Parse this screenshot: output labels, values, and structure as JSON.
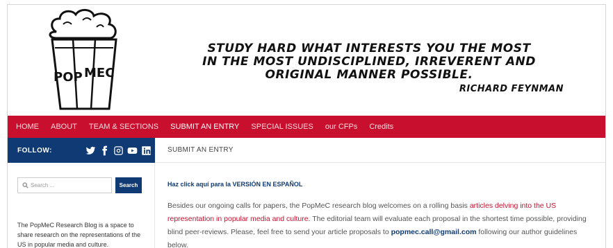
{
  "header": {
    "logo_text_1": "POP",
    "logo_text_2": "MEC",
    "quote_line_1": "STUDY HARD WHAT INTERESTS YOU THE MOST",
    "quote_line_2": "IN THE MOST UNDISCIPLINED, IRREVERENT AND ORIGINAL MANNER POSSIBLE.",
    "quote_author": "RICHARD FEYNMAN"
  },
  "nav": {
    "items": [
      {
        "label": "HOME"
      },
      {
        "label": "ABOUT"
      },
      {
        "label": "TEAM & SECTIONS"
      },
      {
        "label": "SUBMIT AN ENTRY"
      },
      {
        "label": "SPECIAL ISSUES"
      },
      {
        "label": "our CFPs"
      },
      {
        "label": "Credits"
      }
    ],
    "active": "SUBMIT AN ENTRY"
  },
  "follow": {
    "label": "FOLLOW:",
    "icons": [
      "twitter-icon",
      "facebook-icon",
      "instagram-icon",
      "youtube-icon",
      "linkedin-icon"
    ]
  },
  "breadcrumb": "SUBMIT AN ENTRY",
  "sidebar": {
    "search_placeholder": "Search ...",
    "search_button": "Search",
    "about_text": "The PopMeC Research Blog is a space to share research on the representations of the US in popular media and culture."
  },
  "main": {
    "spanish_link": "Haz click aquí para la VERSIÓN EN ESPAÑOL",
    "p1_a": "Besides our ongoing calls for papers, the PopMeC research blog welcomes on a rolling basis ",
    "p1_link": "articles delving into the US representation in popular media and culture",
    "p1_b": ". The editorial team will evaluate each proposal in the shortest time possible, providing blind peer-reviews. Please, feel free to send your article proposals to ",
    "p1_email": "popmec.call@gmail.com",
    "p1_c": " following our author guidelines below."
  },
  "colors": {
    "nav_red": "#c8102e",
    "navy": "#0f3a73"
  }
}
